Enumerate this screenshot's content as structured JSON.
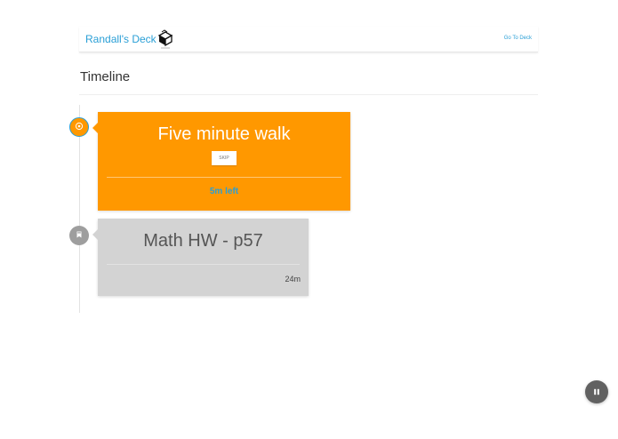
{
  "deck": {
    "title": "Randall's Deck",
    "logo_icon": "deck-logo-icon",
    "go_to_deck_label": "Go To Deck"
  },
  "section": {
    "title": "Timeline"
  },
  "timeline": {
    "items": [
      {
        "title": "Five minute walk",
        "status": "active",
        "skip_label": "SKIP",
        "time_left": "5m left",
        "icon": "target-icon",
        "color": "#ff9800"
      },
      {
        "title": "Math HW - p57",
        "status": "pending",
        "duration": "24m",
        "icon": "bookmark-icon",
        "color": "#d3d3d3"
      }
    ]
  },
  "controls": {
    "pause_icon": "pause-icon"
  },
  "colors": {
    "accent": "#2a9fd6",
    "active": "#ff9800",
    "pending": "#d3d3d3"
  }
}
